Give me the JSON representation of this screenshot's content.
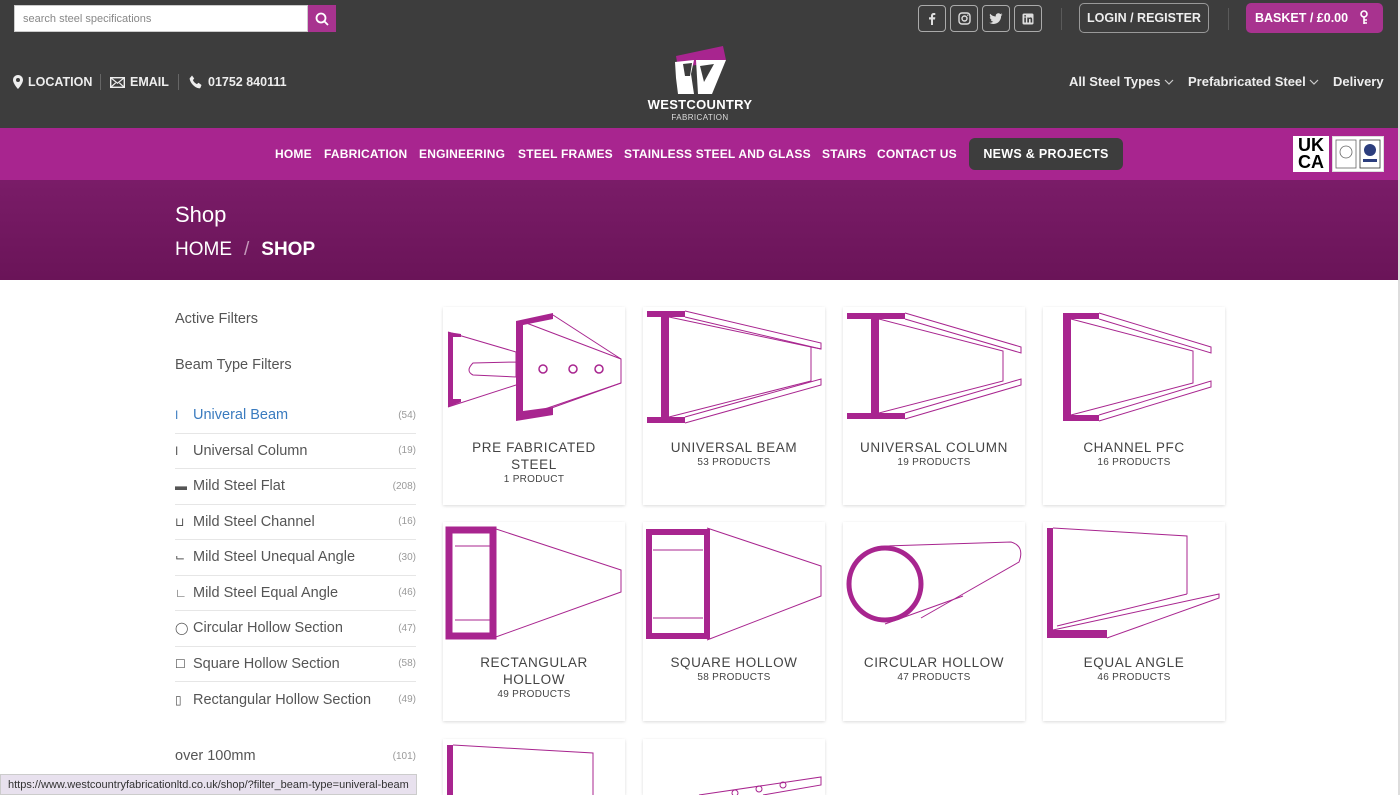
{
  "search": {
    "placeholder": "search steel specifications"
  },
  "topbar": {
    "login_label": "LOGIN / REGISTER",
    "basket_label": "BASKET / £0.00"
  },
  "contact": {
    "location": "LOCATION",
    "email": "EMAIL",
    "phone": "01752 840111"
  },
  "logo": {
    "title": "WESTCOUNTRY",
    "subtitle": "FABRICATION"
  },
  "right_nav": {
    "steel_types": "All Steel Types",
    "prefab": "Prefabricated Steel",
    "delivery": "Delivery"
  },
  "main_nav": {
    "items": [
      "HOME",
      "FABRICATION",
      "ENGINEERING",
      "STEEL FRAMES",
      "STAINLESS STEEL AND GLASS",
      "STAIRS",
      "CONTACT US"
    ],
    "news": "NEWS & PROJECTS"
  },
  "badges": {
    "ukca_top": "UK",
    "ukca_bottom": "CA"
  },
  "banner": {
    "title": "Shop",
    "breadcrumb_home": "HOME",
    "breadcrumb_sep": "/",
    "breadcrumb_current": "SHOP"
  },
  "sidebar": {
    "active_filters": "Active Filters",
    "beam_type_filters": "Beam Type Filters",
    "filters": [
      {
        "icon": "I",
        "label": "Univeral Beam",
        "count": "(54)"
      },
      {
        "icon": "I",
        "label": "Universal Column",
        "count": "(19)"
      },
      {
        "icon": "▬",
        "label": "Mild Steel Flat",
        "count": "(208)"
      },
      {
        "icon": "⊔",
        "label": "Mild Steel Channel",
        "count": "(16)"
      },
      {
        "icon": "⌙",
        "label": "Mild Steel Unequal Angle",
        "count": "(30)"
      },
      {
        "icon": "∟",
        "label": "Mild Steel Equal Angle",
        "count": "(46)"
      },
      {
        "icon": "◯",
        "label": "Circular Hollow Section",
        "count": "(47)"
      },
      {
        "icon": "☐",
        "label": "Square Hollow Section",
        "count": "(58)"
      },
      {
        "icon": "▯",
        "label": "Rectangular Hollow Section",
        "count": "(49)"
      }
    ],
    "extra_filter": {
      "label": "over 100mm",
      "count": "(101)"
    }
  },
  "products": [
    {
      "name": "PRE FABRICATED STEEL",
      "count": "1 PRODUCT"
    },
    {
      "name": "UNIVERSAL BEAM",
      "count": "53 PRODUCTS"
    },
    {
      "name": "UNIVERSAL COLUMN",
      "count": "19 PRODUCTS"
    },
    {
      "name": "CHANNEL PFC",
      "count": "16 PRODUCTS"
    },
    {
      "name": "RECTANGULAR HOLLOW",
      "count": "49 PRODUCTS"
    },
    {
      "name": "SQUARE HOLLOW",
      "count": "58 PRODUCTS"
    },
    {
      "name": "CIRCULAR HOLLOW",
      "count": "47 PRODUCTS"
    },
    {
      "name": "EQUAL ANGLE",
      "count": "46 PRODUCTS"
    }
  ],
  "status_url": "https://www.westcountryfabricationltd.co.uk/shop/?filter_beam-type=univeral-beam",
  "colors": {
    "brand_purple": "#a8258f",
    "dark_bar": "#3d3d3d",
    "banner_purple": "#6a1458",
    "link_blue": "#3a7bbf"
  },
  "icons": [
    "search-icon",
    "facebook-icon",
    "instagram-icon",
    "twitter-icon",
    "linkedin-icon",
    "basket-icon",
    "location-icon",
    "email-icon",
    "phone-icon",
    "chevron-down-icon"
  ]
}
